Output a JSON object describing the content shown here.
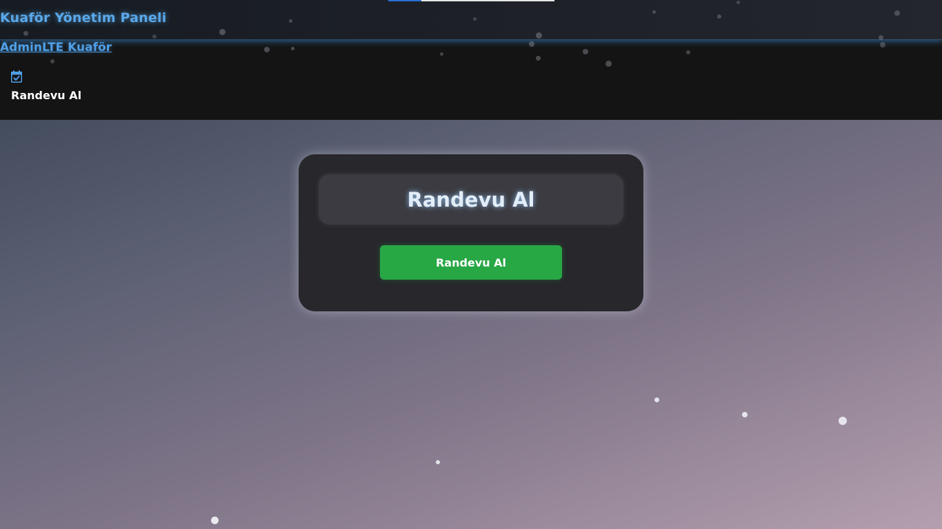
{
  "header": {
    "title": "Kuaför Yönetim Paneli",
    "brand_link": "AdminLTE Kuaför"
  },
  "nav": {
    "items": [
      {
        "label": "Randevu Al",
        "icon": "calendar-check-icon"
      }
    ]
  },
  "card": {
    "title": "Randevu Al",
    "button_label": "Randevu Al"
  },
  "colors": {
    "accent": "#5aa8ea",
    "button": "#28a745",
    "card_bg": "#27272c",
    "topbar_bg": "#141414"
  }
}
